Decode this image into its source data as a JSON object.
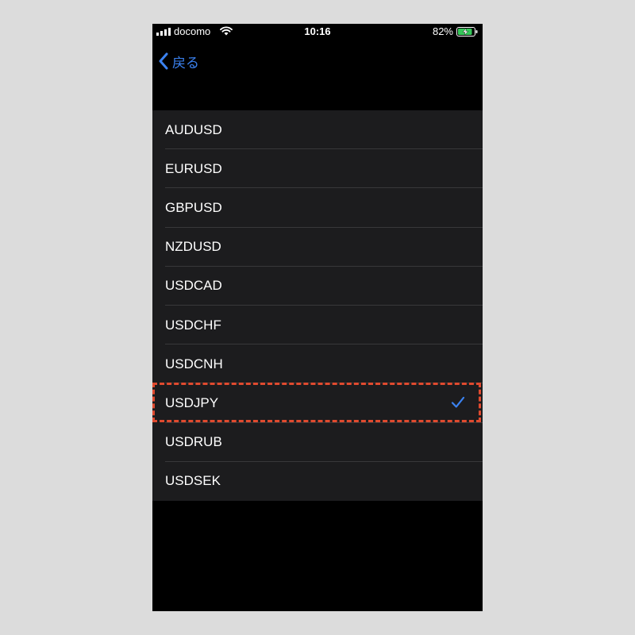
{
  "status_bar": {
    "carrier": "docomo",
    "time": "10:16",
    "battery_percent": "82%",
    "battery_level": 0.82,
    "charging": true
  },
  "nav": {
    "back_label": "戻る",
    "back_icon": "chevron-left-icon"
  },
  "list": {
    "items": [
      {
        "label": "AUDUSD",
        "selected": false
      },
      {
        "label": "EURUSD",
        "selected": false
      },
      {
        "label": "GBPUSD",
        "selected": false
      },
      {
        "label": "NZDUSD",
        "selected": false
      },
      {
        "label": "USDCAD",
        "selected": false
      },
      {
        "label": "USDCHF",
        "selected": false
      },
      {
        "label": "USDCNH",
        "selected": false
      },
      {
        "label": "USDJPY",
        "selected": true
      },
      {
        "label": "USDRUB",
        "selected": false
      },
      {
        "label": "USDSEK",
        "selected": false
      }
    ]
  },
  "colors": {
    "accent": "#3b82f0",
    "list_background": "#1c1c1e",
    "highlight": "#e04a2f"
  }
}
